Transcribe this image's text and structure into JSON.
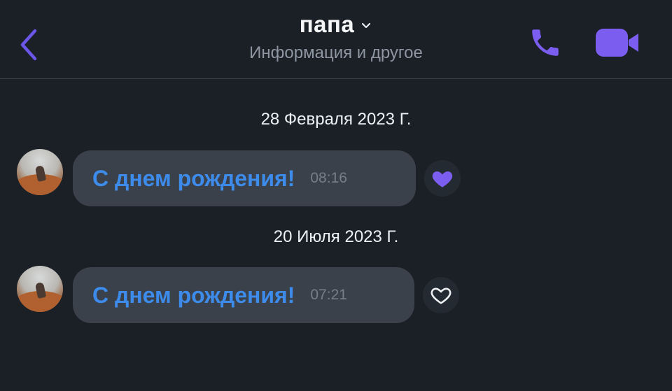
{
  "header": {
    "title": "папа",
    "subtitle": "Информация и другое"
  },
  "messages": [
    {
      "date": "28 Февраля 2023 Г.",
      "text": "С днем рождения!",
      "time": "08:16",
      "liked": true
    },
    {
      "date": "20 Июля 2023 Г.",
      "text": "С днем рождения!",
      "time": "07:21",
      "liked": false
    }
  ],
  "colors": {
    "background": "#1b2027",
    "accent": "#7b5ef0",
    "bubble": "#3a414b",
    "message_text": "#3d8bea"
  },
  "icons": {
    "back": "chevron-left-icon",
    "title_dropdown": "chevron-down-icon",
    "call": "phone-icon",
    "video": "video-camera-icon",
    "liked": "heart-filled-icon",
    "unliked": "heart-outline-icon"
  }
}
